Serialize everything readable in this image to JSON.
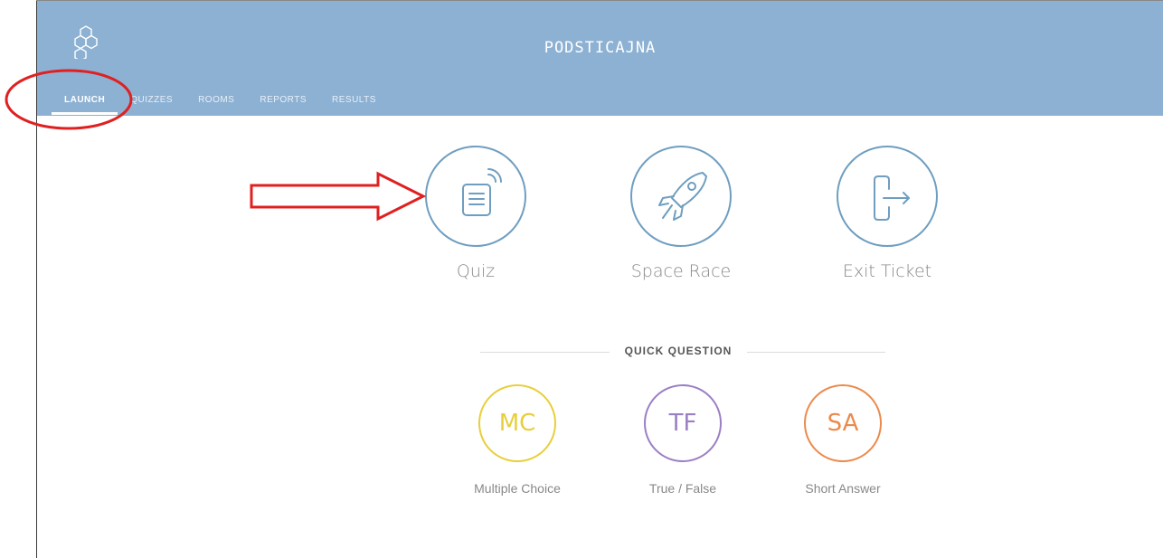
{
  "header": {
    "room_name": "PODSTICAJNA",
    "logo_icon": "hexagon-logo-icon",
    "background_color": "#8db1d3"
  },
  "tabs": [
    {
      "label": "LAUNCH",
      "active": true
    },
    {
      "label": "QUIZZES",
      "active": false
    },
    {
      "label": "ROOMS",
      "active": false
    },
    {
      "label": "REPORTS",
      "active": false
    },
    {
      "label": "RESULTS",
      "active": false
    }
  ],
  "launch_options": [
    {
      "label": "Quiz",
      "icon": "quiz-document-icon"
    },
    {
      "label": "Space Race",
      "icon": "rocket-icon"
    },
    {
      "label": "Exit Ticket",
      "icon": "exit-door-icon"
    }
  ],
  "quick_question": {
    "title": "QUICK QUESTION",
    "options": [
      {
        "abbr": "MC",
        "label": "Multiple Choice",
        "color": "#e8cf3a"
      },
      {
        "abbr": "TF",
        "label": "True / False",
        "color": "#9b7fc4"
      },
      {
        "abbr": "SA",
        "label": "Short Answer",
        "color": "#ec8a4c"
      }
    ]
  },
  "annotations": {
    "highlight_color": "#e02020"
  }
}
